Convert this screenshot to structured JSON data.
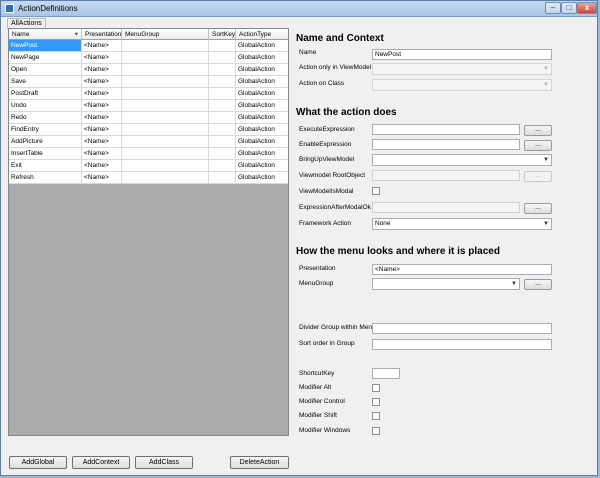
{
  "window": {
    "title": "ActionDefinitions"
  },
  "tabs": [
    "AllActions"
  ],
  "grid": {
    "columns": [
      "Name",
      "Presentation",
      "MenuGroup",
      "SortKey",
      "ActionType"
    ],
    "rows": [
      [
        "NewPost",
        "<Name>",
        "",
        "",
        "GlobalAction"
      ],
      [
        "NewPage",
        "<Name>",
        "",
        "",
        "GlobalAction"
      ],
      [
        "Open",
        "<Name>",
        "",
        "",
        "GlobalAction"
      ],
      [
        "Save",
        "<Name>",
        "",
        "",
        "GlobalAction"
      ],
      [
        "PostDraft",
        "<Name>",
        "",
        "",
        "GlobalAction"
      ],
      [
        "Undo",
        "<Name>",
        "",
        "",
        "GlobalAction"
      ],
      [
        "Redo",
        "<Name>",
        "",
        "",
        "GlobalAction"
      ],
      [
        "FindEntry",
        "<Name>",
        "",
        "",
        "GlobalAction"
      ],
      [
        "AddPicture",
        "<Name>",
        "",
        "",
        "GlobalAction"
      ],
      [
        "InsertTable",
        "<Name>",
        "",
        "",
        "GlobalAction"
      ],
      [
        "Exit",
        "<Name>",
        "",
        "",
        "GlobalAction"
      ],
      [
        "Refresh",
        "<Name>",
        "",
        "",
        "GlobalAction"
      ]
    ]
  },
  "buttons": {
    "add_global": "AddGlobal",
    "add_context": "AddContext",
    "add_class": "AddClass",
    "delete_action": "DeleteAction"
  },
  "section_name": {
    "title": "Name and Context",
    "name_label": "Name",
    "name_value": "NewPost",
    "viewmodel_label": "Action only in ViewModel",
    "class_label": "Action on Class"
  },
  "section_does": {
    "title": "What the action does",
    "execute_label": "ExecuteExpression",
    "enable_label": "EnableExpression",
    "bringup_label": "BringUpViewModel",
    "rootobject_label": "Viewmodel RootObject",
    "modal_label": "ViewModelIsModal",
    "aftermodal_label": "ExpressionAfterModalOk",
    "framework_label": "Framework Action",
    "framework_value": "None",
    "dots": "..."
  },
  "section_menu": {
    "title": "How the menu looks and where it is placed",
    "presentation_label": "Presentation",
    "presentation_value": "<Name>",
    "menugroup_label": "MenuGroup",
    "divider_label": "Divider Group within Menu",
    "sortorder_label": "Sort order in Group",
    "shortcut_label": "ShortcutKey",
    "alt_label": "Modifier Alt",
    "control_label": "Modifier Control",
    "shift_label": "Modifier Shift",
    "windows_label": "Modifier Windows"
  }
}
